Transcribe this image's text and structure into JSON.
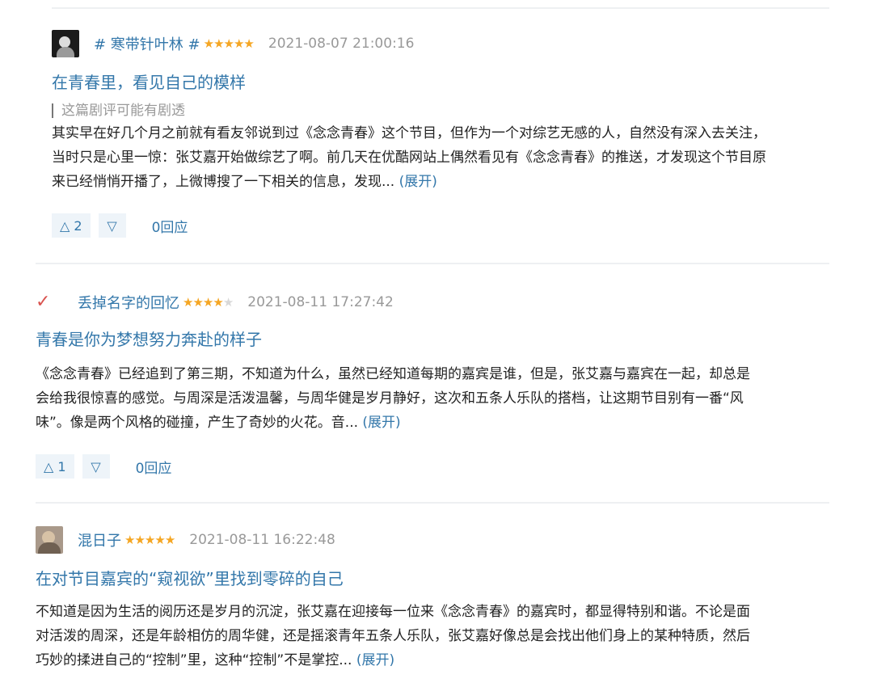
{
  "reviews": [
    {
      "author": "# 寒带针叶林 #",
      "stars_filled": 5,
      "stars_total": 5,
      "time": "2021-08-07 21:00:16",
      "title": "在青春里，看见自己的模样",
      "spoiler": "这篇剧评可能有剧透",
      "body_lines": [
        "其实早在好几个月之前就有看友邻说到过《念念青春》这个节目，但作为一个对综艺无感的人，自然没有深入去关注，",
        "当时只是心里一惊：张艾嘉开始做综艺了啊。前几天在优酷网站上偶然看见有《念念青春》的推送，才发现这个节目原",
        "来已经悄悄开播了，上微博搜了一下相关的信息，发现... "
      ],
      "expand": "(展开)",
      "useful": "△ 2",
      "useless": "▽",
      "replies": "0回应"
    },
    {
      "author": "丢掉名字的回忆",
      "stars_filled": 4,
      "stars_total": 5,
      "time": "2021-08-11 17:27:42",
      "title": "青春是你为梦想努力奔赴的样子",
      "body_lines": [
        "《念念青春》已经追到了第三期，不知道为什么，虽然已经知道每期的嘉宾是谁，但是，张艾嘉与嘉宾在一起，却总是",
        "会给我很惊喜的感觉。与周深是活泼温馨，与周华健是岁月静好，这次和五条人乐队的搭档，让这期节目别有一番“风",
        "味”。像是两个风格的碰撞，产生了奇妙的火花。音... "
      ],
      "expand": "(展开)",
      "useful": "△ 1",
      "useless": "▽",
      "replies": "0回应"
    },
    {
      "author": "混日子",
      "stars_filled": 5,
      "stars_total": 5,
      "time": "2021-08-11 16:22:48",
      "title": "在对节目嘉宾的“窥视欲”里找到零碎的自己",
      "body_lines": [
        "不知道是因为生活的阅历还是岁月的沉淀，张艾嘉在迎接每一位来《念念青春》的嘉宾时，都显得特别和谐。不论是面",
        "对活泼的周深，还是年龄相仿的周华健，还是摇滚青年五条人乐队，张艾嘉好像总是会找出他们身上的某种特质，然后",
        "巧妙的揉进自己的“控制”里，这种“控制”不是掌控... "
      ],
      "expand": "(展开)"
    }
  ],
  "icons": {
    "check": "✓",
    "star": "★"
  },
  "colors": {
    "link": "#3377aa",
    "star": "#f5a623",
    "muted": "#999999",
    "divider": "#eef0f2"
  }
}
